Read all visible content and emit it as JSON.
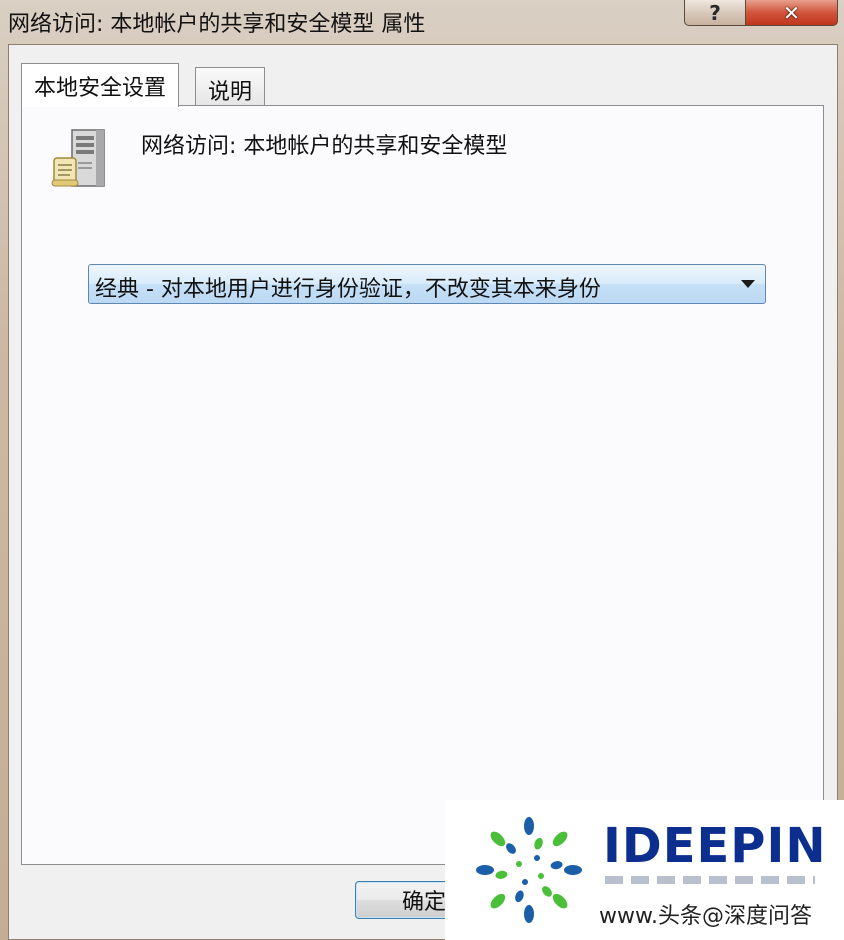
{
  "window": {
    "title": "网络访问: 本地帐户的共享和安全模型 属性",
    "help_glyph": "?",
    "close_glyph": "✕"
  },
  "tabs": [
    {
      "label": "本地安全设置",
      "active": true
    },
    {
      "label": "说明",
      "active": false
    }
  ],
  "policy": {
    "icon": "server-policy-icon",
    "title": "网络访问: 本地帐户的共享和安全模型"
  },
  "combo": {
    "selected": "经典 - 对本地用户进行身份验证，不改变其本来身份"
  },
  "buttons": {
    "ok": "确定"
  },
  "watermark": {
    "brand": "IDEEPIN",
    "caption": "www.头条@深度问答",
    "colors": {
      "brand": "#0c2f8f",
      "green": "#4bbf3a",
      "blue": "#1a5fa8"
    }
  }
}
